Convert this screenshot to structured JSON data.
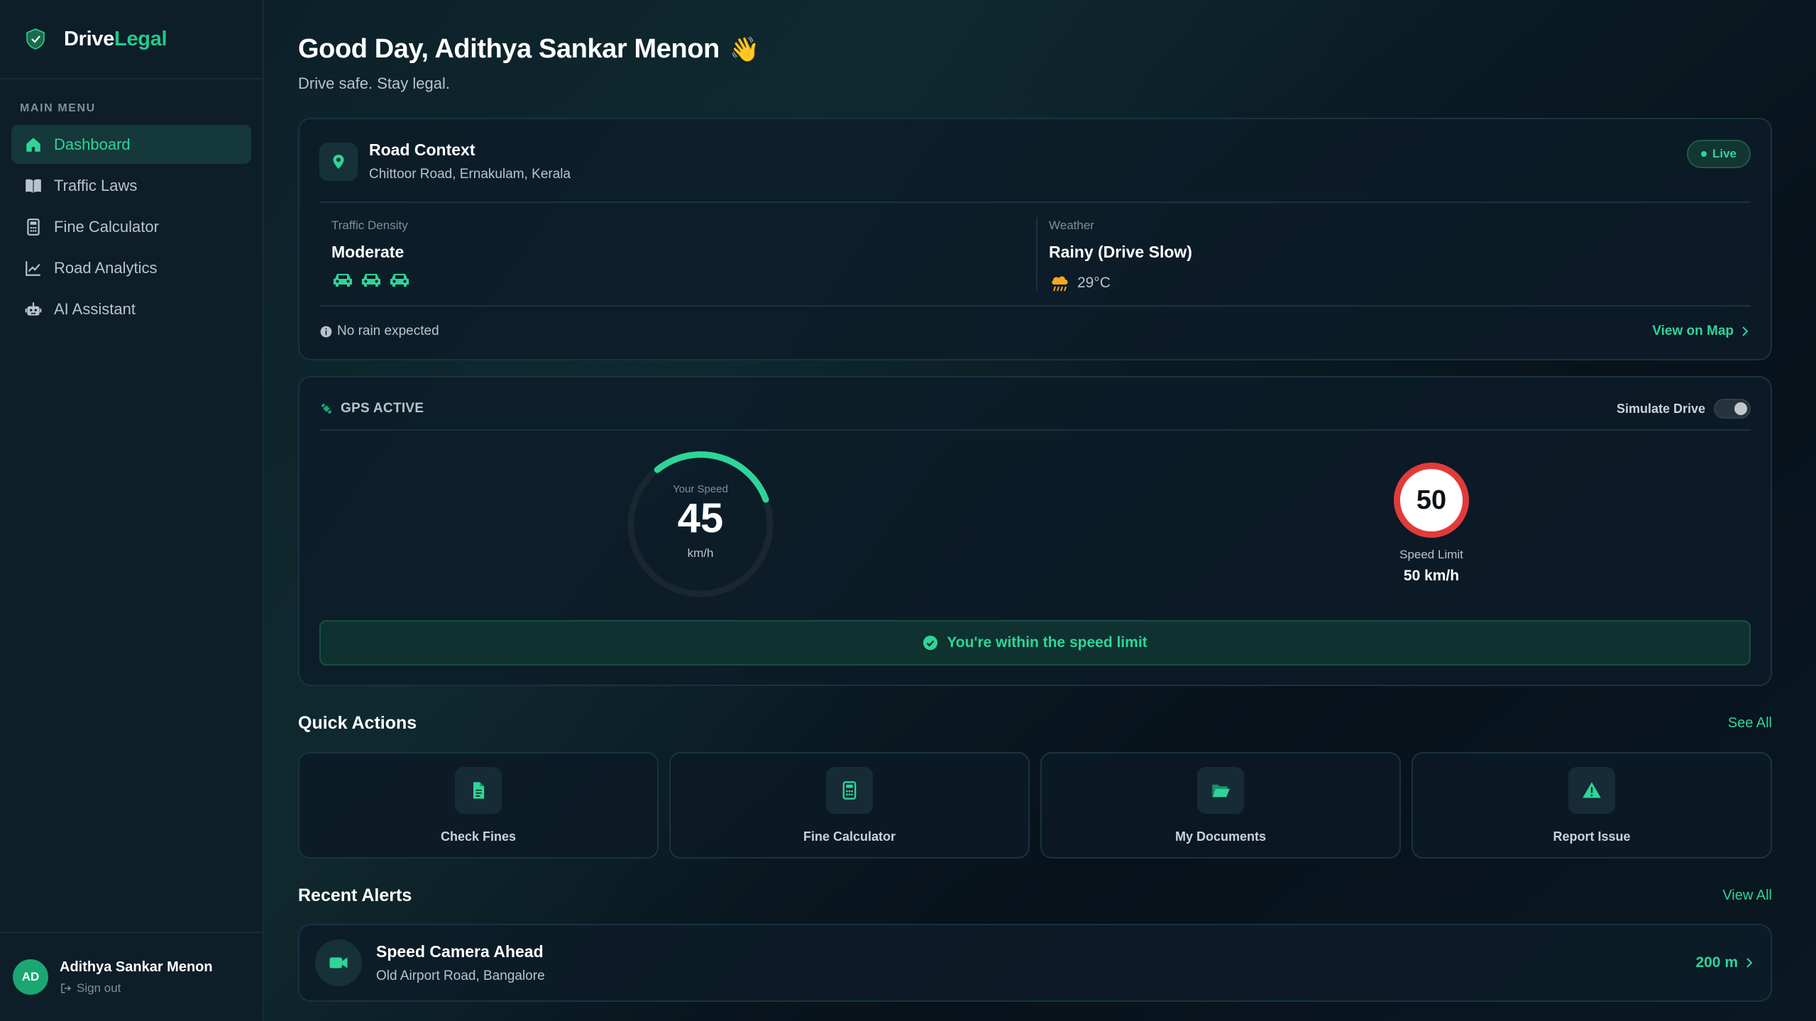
{
  "brand": {
    "name_part1": "Drive",
    "name_part2": "Legal"
  },
  "sidebar": {
    "menu_title": "MAIN MENU",
    "items": [
      {
        "label": "Dashboard",
        "icon": "home-icon",
        "active": true
      },
      {
        "label": "Traffic Laws",
        "icon": "book-icon",
        "active": false
      },
      {
        "label": "Fine Calculator",
        "icon": "calculator-icon",
        "active": false
      },
      {
        "label": "Road Analytics",
        "icon": "chart-line-icon",
        "active": false
      },
      {
        "label": "AI Assistant",
        "icon": "robot-icon",
        "active": false
      }
    ],
    "user": {
      "initials": "AD",
      "name": "Adithya Sankar Menon",
      "signout": "Sign out"
    }
  },
  "header": {
    "greeting": "Good Day, Adithya Sankar Menon",
    "wave": "👋",
    "subtitle": "Drive safe. Stay legal."
  },
  "road_context": {
    "title": "Road Context",
    "location": "Chittoor Road, Ernakulam, Kerala",
    "badge": "Live",
    "traffic_label": "Traffic Density",
    "traffic_value": "Moderate",
    "weather_label": "Weather",
    "weather_value": "Rainy (Drive Slow)",
    "temperature": "29°C",
    "note": "No rain expected",
    "map_link": "View on Map"
  },
  "gps": {
    "status": "GPS ACTIVE",
    "simulate_label": "Simulate Drive",
    "simulate_on": false,
    "speed_label": "Your Speed",
    "speed": "45",
    "speed_unit": "km/h",
    "limit_sign": "50",
    "limit_label": "Speed Limit",
    "limit_value": "50 km/h",
    "status_message": "You're within the speed limit"
  },
  "quick_actions": {
    "title": "Quick Actions",
    "link": "See All",
    "items": [
      {
        "label": "Check Fines",
        "icon": "file-icon"
      },
      {
        "label": "Fine Calculator",
        "icon": "calculator-icon"
      },
      {
        "label": "My Documents",
        "icon": "folder-open-icon"
      },
      {
        "label": "Report Issue",
        "icon": "warning-icon"
      }
    ]
  },
  "recent_alerts": {
    "title": "Recent Alerts",
    "link": "View All",
    "items": [
      {
        "title": "Speed Camera Ahead",
        "location": "Old Airport Road, Bangalore",
        "distance": "200 m",
        "icon": "video-camera-icon"
      }
    ]
  },
  "colors": {
    "accent": "#2ed598",
    "danger": "#e23a3a",
    "background": "#0a1520"
  }
}
